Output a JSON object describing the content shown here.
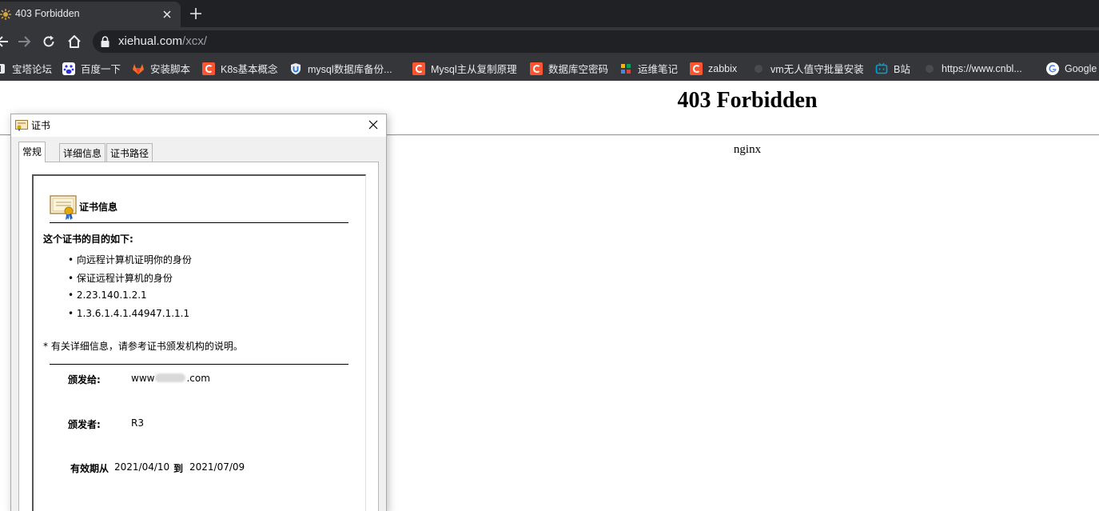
{
  "browser": {
    "tab_title": "403 Forbidden",
    "url_host": "xiehual.com",
    "url_path": "/xcx/",
    "bookmarks": [
      {
        "label": "宝塔论坛",
        "icon": "baota-icon"
      },
      {
        "label": "百度一下",
        "icon": "baidu-icon"
      },
      {
        "label": "安装脚本",
        "icon": "gitlab-icon"
      },
      {
        "label": "K8s基本概念",
        "icon": "csdn-icon"
      },
      {
        "label": "mysql数据库备份...",
        "icon": "shield-u-icon"
      },
      {
        "label": "Mysql主从复制原理",
        "icon": "csdn-icon"
      },
      {
        "label": "数据库空密码",
        "icon": "csdn-icon"
      },
      {
        "label": "运维笔记",
        "icon": "puzzle-icon"
      },
      {
        "label": "zabbix",
        "icon": "csdn-icon"
      },
      {
        "label": "vm无人值守批量安装",
        "icon": "generic-page-icon"
      },
      {
        "label": "B站",
        "icon": "bilibili-icon"
      },
      {
        "label": "https://www.cnbl...",
        "icon": "generic-page-icon"
      },
      {
        "label": "Google",
        "icon": "google-icon"
      }
    ],
    "colors": {
      "chrome_dark": "#202124",
      "chrome_toolbar": "#35363a",
      "csdn_red": "#fc5531"
    }
  },
  "page": {
    "heading": "403 Forbidden",
    "footer": "nginx"
  },
  "dialog": {
    "title": "证书",
    "tabs": [
      "常规",
      "详细信息",
      "证书路径"
    ],
    "active_tab": "常规",
    "info_heading": "证书信息",
    "purpose_heading": "这个证书的目的如下:",
    "purposes": [
      "• 向远程计算机证明你的身份",
      "• 保证远程计算机的身份",
      "• 2.23.140.1.2.1",
      "• 1.3.6.1.4.1.44947.1.1.1"
    ],
    "note": "* 有关详细信息，请参考证书颁发机构的说明。",
    "issued_to_label": "颁发给:",
    "issued_to_value_prefix": "www",
    "issued_to_value_suffix": ".com",
    "issued_by_label": "颁发者:",
    "issued_by_value": "R3",
    "valid_label": "有效期从",
    "valid_from": "2021/04/10",
    "valid_to_label": "到",
    "valid_to": "2021/07/09"
  }
}
